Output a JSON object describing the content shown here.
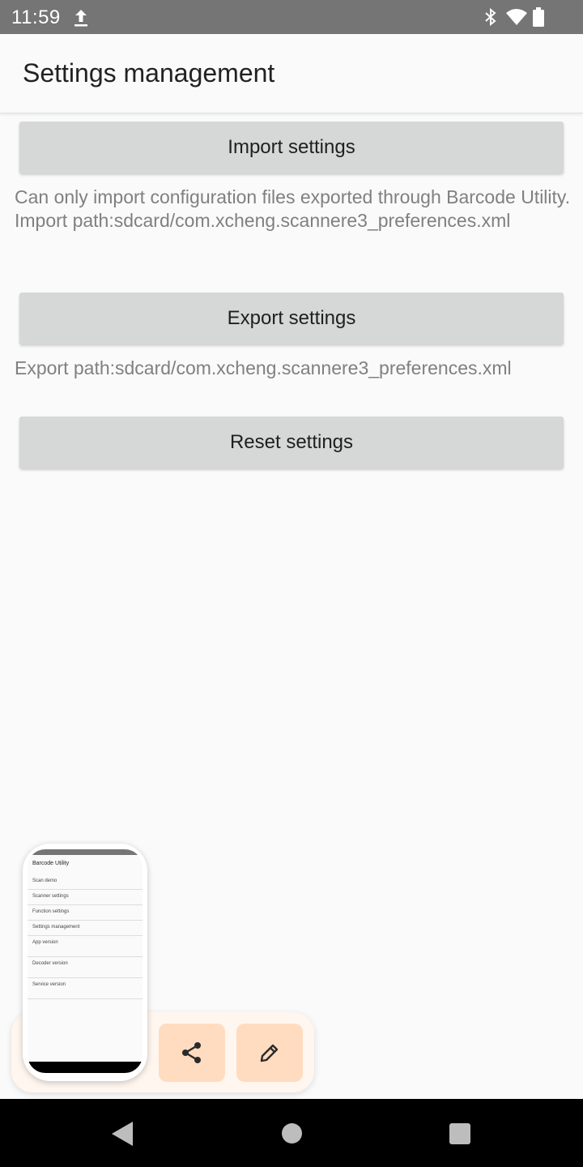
{
  "status_bar": {
    "time": "11:59",
    "icons": [
      "upload-icon",
      "bluetooth-icon",
      "wifi-icon",
      "battery-icon"
    ]
  },
  "app_bar": {
    "title": "Settings management"
  },
  "import_section": {
    "button_label": "Import settings",
    "description_line1": "Can only import configuration files exported through Barcode Utility.",
    "description_line2": "Import path:sdcard/com.xcheng.scannere3_preferences.xml"
  },
  "export_section": {
    "button_label": "Export settings",
    "description": "Export path:sdcard/com.xcheng.scannere3_preferences.xml"
  },
  "reset_section": {
    "button_label": "Reset settings"
  },
  "screenshot_preview": {
    "title": "Barcode Utility",
    "rows": [
      "Scan demo",
      "Scanner settings",
      "Function settings",
      "Settings management",
      "App version",
      "Decoder version",
      "Service version"
    ],
    "actions": [
      "share-icon",
      "edit-icon"
    ]
  },
  "nav_bar": {
    "buttons": [
      "back-icon",
      "home-icon",
      "recents-icon"
    ]
  },
  "colors": {
    "status_bar": "#757575",
    "button_bg": "#d6d7d7",
    "description_text": "#808080",
    "preview_panel": "#fff6ef",
    "preview_action": "#ffdcc0"
  }
}
